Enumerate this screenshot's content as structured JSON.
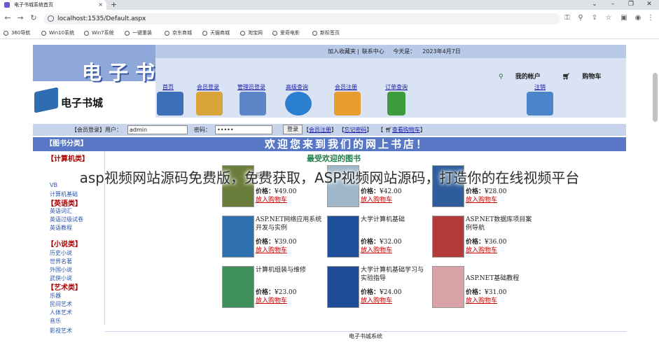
{
  "browser": {
    "tab_title": "电子书城系统首页",
    "tab_close": "×",
    "new_tab": "+",
    "url": "localhost:1535/Default.aspx",
    "window_buttons": [
      "⌄",
      "–",
      "❐",
      "✕"
    ],
    "nav": {
      "back": "←",
      "forward": "→",
      "reload": "↻"
    },
    "tool_icons": [
      "⚿",
      "⚲",
      "⇪",
      "☆",
      "▣",
      "◉",
      "⋮"
    ]
  },
  "bookmarks": [
    "360导航",
    "Win10系统",
    "Win7系统",
    "一键重装",
    "京东商城",
    "天猫商城",
    "淘宝网",
    "爱奇电影",
    "新标签页"
  ],
  "header": {
    "title": "电子书城",
    "logo_text": "电子书城",
    "top_links": [
      "加入收藏夹",
      "联系中心"
    ],
    "separator": "|",
    "date_label": "今天是：",
    "date_value": "2023年4月7日",
    "account": "我的帐户",
    "cart": "购物车",
    "nav": [
      "首页",
      "会员登录",
      "管理员登录",
      "高级查询",
      "会员注册",
      "订单查询",
      "注销"
    ]
  },
  "login": {
    "label": "【会员登录】用户：",
    "user_value": "admin",
    "password_label": "密码：",
    "password_value": "•••••",
    "button": "登录",
    "links": [
      "会员注册",
      "忘记密码",
      "查看购物车"
    ],
    "bracket_open": "【",
    "bracket_close": "】"
  },
  "sidebar": {
    "header": "【图书分类】",
    "categories": [
      {
        "title": "【计算机类】",
        "items": [
          "VB",
          "计算机基础"
        ]
      },
      {
        "title": "【英语类】",
        "items": [
          "英语词汇",
          "英语过级试卷",
          "英语教程"
        ]
      },
      {
        "title": "【小说类】",
        "items": [
          "历史小说",
          "世界名著",
          "外国小说",
          "武侠小说"
        ]
      },
      {
        "title": "【艺术类】",
        "items": [
          "乐器",
          "民间艺术",
          "人体艺术",
          "音乐",
          "影视艺术"
        ]
      }
    ]
  },
  "main": {
    "welcome": "欢迎您来到我们的网上书店！",
    "section_title": "最受欢迎的图书",
    "price_label": "价格：",
    "buy_label": "放入购物车",
    "books": [
      {
        "title": "导航",
        "price": "¥49.00"
      },
      {
        "title": "",
        "price": "¥42.00"
      },
      {
        "title": "",
        "price": "¥28.00"
      },
      {
        "title": "ASP.NET网络应用系统开发与实例",
        "price": "¥39.00"
      },
      {
        "title": "大学计算机基础",
        "price": "¥32.00"
      },
      {
        "title": "ASP.NET数据库项目案例导航",
        "price": "¥36.00"
      },
      {
        "title": "计算机组装与维修",
        "price": "¥23.00"
      },
      {
        "title": "大学计算机基础学习与实验指导",
        "price": "¥24.00"
      },
      {
        "title": "ASP.NET基础教程",
        "price": "¥31.00"
      }
    ],
    "footer": "电子书城系统"
  },
  "overlay_caption": "asp视频网站源码免费版，免费获取，ASP视频网站源码，打造你的在线视频平台",
  "colors": {
    "banner": "#8fa8da",
    "header_bg": "#d9e3f3",
    "bar_blue": "#5877c4",
    "link": "#1a1aa6",
    "category": "#b00000",
    "buy": "#c00000"
  }
}
